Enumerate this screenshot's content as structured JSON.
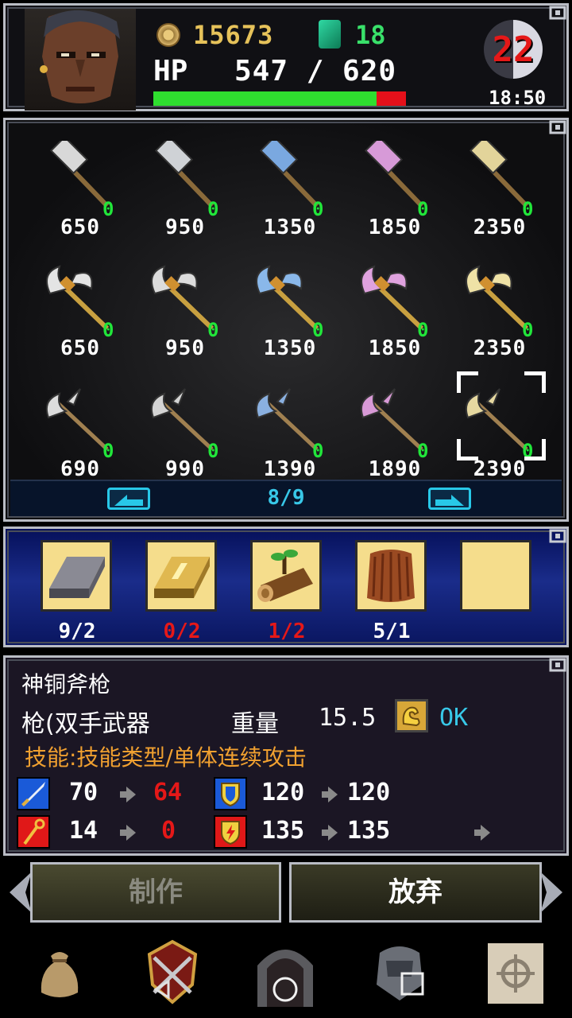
{
  "header": {
    "coins": "15673",
    "gems": "18",
    "hp_label": "HP",
    "hp_value": "547 / 620",
    "hp_current": 547,
    "hp_max": 620,
    "day": "22",
    "time": "18:50"
  },
  "weapons": {
    "rows": [
      [
        {
          "type": "hammer",
          "color": "#d8d8d8",
          "count": "0",
          "price": "650"
        },
        {
          "type": "hammer",
          "color": "#cfd2d6",
          "count": "0",
          "price": "950"
        },
        {
          "type": "hammer",
          "color": "#7aa8e0",
          "count": "0",
          "price": "1350"
        },
        {
          "type": "hammer",
          "color": "#d79ad8",
          "count": "0",
          "price": "1850"
        },
        {
          "type": "hammer",
          "color": "#e2d49a",
          "count": "0",
          "price": "2350"
        }
      ],
      [
        {
          "type": "axe",
          "color": "#e4e4e4",
          "count": "0",
          "price": "650"
        },
        {
          "type": "axe",
          "color": "#dcdcdc",
          "count": "0",
          "price": "950"
        },
        {
          "type": "axe",
          "color": "#8ab8ea",
          "count": "0",
          "price": "1350"
        },
        {
          "type": "axe",
          "color": "#dfa2de",
          "count": "0",
          "price": "1850"
        },
        {
          "type": "axe",
          "color": "#efe2a6",
          "count": "0",
          "price": "2350"
        }
      ],
      [
        {
          "type": "halberd",
          "color": "#dcdcdc",
          "count": "0",
          "price": "690"
        },
        {
          "type": "halberd",
          "color": "#d4d4d4",
          "count": "0",
          "price": "990"
        },
        {
          "type": "halberd",
          "color": "#8ab0e0",
          "count": "0",
          "price": "1390"
        },
        {
          "type": "halberd",
          "color": "#d89ad6",
          "count": "0",
          "price": "1890"
        },
        {
          "type": "halberd",
          "color": "#e6d8a0",
          "count": "0",
          "price": "2390"
        }
      ]
    ],
    "page": "8/9"
  },
  "materials": [
    {
      "name": "iron-ingot",
      "text": "9/2",
      "color": "#ffffff"
    },
    {
      "name": "gold-ingot",
      "text": "0/2",
      "color": "#e51818"
    },
    {
      "name": "wood-log",
      "text": "1/2",
      "color": "#e51818"
    },
    {
      "name": "leather",
      "text": "5/1",
      "color": "#ffffff"
    },
    {
      "name": "empty",
      "text": "",
      "color": "#ffffff"
    }
  ],
  "info": {
    "name": "神铜斧枪",
    "category": "枪(双手武器",
    "weight_label": "重量",
    "weight_value": "15.5",
    "ok": "OK",
    "skill": "技能:技能类型/单体连续攻击",
    "atk_from": "70",
    "atk_to": "64",
    "def_from": "120",
    "def_to": "120",
    "mag_from": "14",
    "mag_to": "0",
    "spd_from": "135",
    "spd_to": "135",
    "colors": {
      "down": "#e51818",
      "same": "#ffffff"
    }
  },
  "actions": {
    "craft": "制作",
    "discard": "放弃"
  },
  "nav": [
    "bag-icon",
    "crest-icon",
    "dungeon-gate-icon",
    "armor-icon",
    "map-icon"
  ]
}
